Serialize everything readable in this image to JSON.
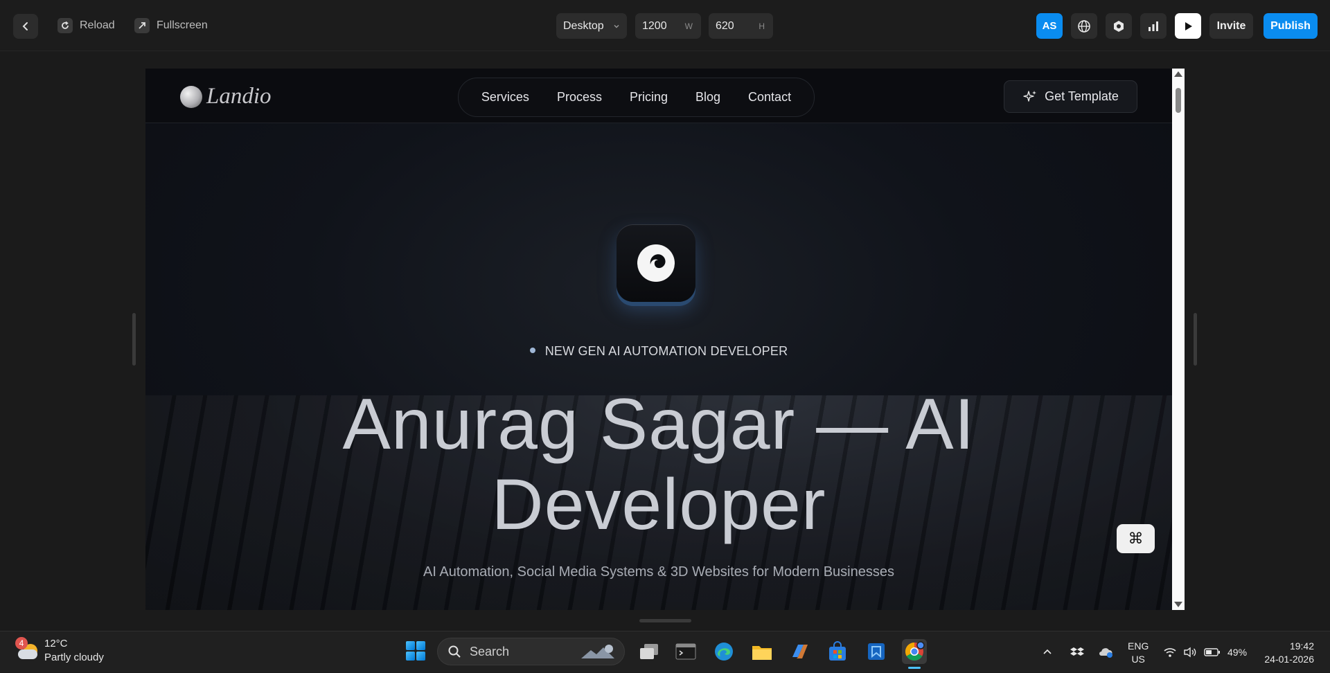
{
  "toolbar": {
    "reload_label": "Reload",
    "fullscreen_label": "Fullscreen",
    "device": "Desktop",
    "width_value": "1200",
    "width_suffix": "W",
    "height_value": "620",
    "height_suffix": "H",
    "avatar_initials": "AS",
    "invite_label": "Invite",
    "publish_label": "Publish",
    "accent": "#0a8cf0"
  },
  "site": {
    "brand": "Landio",
    "nav": [
      "Services",
      "Process",
      "Pricing",
      "Blog",
      "Contact"
    ],
    "cta_label": "Get Template",
    "tagline": "NEW GEN AI AUTOMATION DEVELOPER",
    "title_line1": "Anurag Sagar — AI",
    "title_line2": "Developer",
    "subtitle": "AI Automation, Social Media Systems & 3D Websites for Modern Businesses",
    "command_icon": "⌘"
  },
  "taskbar": {
    "weather_badge": "4",
    "temperature": "12°C",
    "condition": "Partly cloudy",
    "search_placeholder": "Search",
    "lang_top": "ENG",
    "lang_bottom": "US",
    "battery": "49%",
    "time": "19:42",
    "date": "24-01-2026"
  }
}
